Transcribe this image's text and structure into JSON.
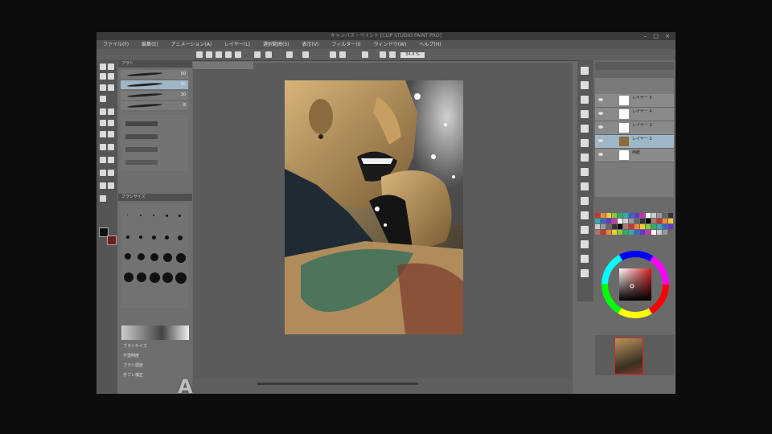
{
  "window": {
    "title": "キャンバス・ペイント [CLIP STUDIO PAINT PRO]",
    "controls": "– □ ×"
  },
  "menu": [
    "ファイル(F)",
    "編集(E)",
    "アニメーション(A)",
    "レイヤー(L)",
    "選択範囲(S)",
    "表示(V)",
    "フィルター(I)",
    "ウィンドウ(W)",
    "ヘルプ(H)"
  ],
  "toolbar": {
    "zoom_value": "34.4 %"
  },
  "brush_panel": {
    "header": "ブラシ",
    "brushes": [
      {
        "size": "50"
      },
      {
        "size": "50",
        "selected": true
      },
      {
        "size": "30"
      },
      {
        "size": "8"
      }
    ],
    "size_header": "ブラシサイズ",
    "props": [
      "ブラシサイズ",
      "不透明度",
      "ブラシ濃度",
      "手ブレ補正"
    ]
  },
  "layers": [
    {
      "name": "レイヤー 5"
    },
    {
      "name": "レイヤー 4"
    },
    {
      "name": "レイヤー 3"
    },
    {
      "name": "レイヤー 2",
      "active": true
    },
    {
      "name": "用紙"
    }
  ],
  "watermark": "AMV",
  "colors": {
    "foreground": "#111111",
    "background": "#6e1b1b",
    "canvas_bg": "#5b5b5b"
  }
}
